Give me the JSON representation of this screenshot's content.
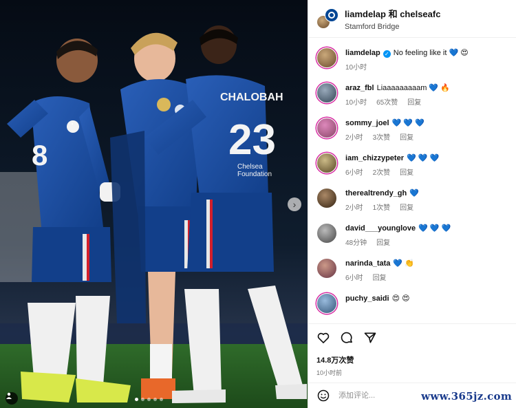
{
  "photo": {
    "jersey_name": "CHALOBAH",
    "jersey_number": "23",
    "left_number": "8",
    "foundation_text_1": "Chelsea",
    "foundation_text_2": "Foundation",
    "next_glyph": "›"
  },
  "header": {
    "title": "liamdelap 和 chelseafc",
    "location": "Stamford Bridge"
  },
  "comments": [
    {
      "user": "liamdelap",
      "verified": true,
      "text": "No feeling like it 💙 😍",
      "time": "10小时",
      "likes": "",
      "reply": ""
    },
    {
      "user": "araz_fbl",
      "verified": false,
      "text": "Liaaaaaaaaam 💙 🔥",
      "time": "10小时",
      "likes": "65次赞",
      "reply": "回复"
    },
    {
      "user": "sommy_joel",
      "verified": false,
      "text": "💙 💙 💙",
      "time": "2小时",
      "likes": "3次赞",
      "reply": "回复"
    },
    {
      "user": "iam_chizzypeter",
      "verified": false,
      "text": "💙 💙 💙",
      "time": "6小时",
      "likes": "2次赞",
      "reply": "回复"
    },
    {
      "user": "therealtrendy_gh",
      "verified": false,
      "text": "💙",
      "time": "2小时",
      "likes": "1次赞",
      "reply": "回复"
    },
    {
      "user": "david___younglove",
      "verified": false,
      "text": "💙 💙 💙",
      "time": "48分钟",
      "likes": "",
      "reply": "回复"
    },
    {
      "user": "narinda_tata",
      "verified": false,
      "text": "💙 👏",
      "time": "6小时",
      "likes": "",
      "reply": "回复"
    },
    {
      "user": "puchy_saidi",
      "verified": false,
      "text": "😍 😍",
      "time": "",
      "likes": "",
      "reply": ""
    }
  ],
  "post": {
    "likes": "14.8万次赞",
    "time": "10小时前"
  },
  "add_comment": {
    "placeholder": "添加评论..."
  },
  "watermark": "www.365jz.com",
  "colors": {
    "chelsea_blue": "#034694",
    "heart_blue": "#3d7be0",
    "verified": "#0095f6"
  },
  "icons": [
    "heart-icon",
    "comment-icon",
    "share-icon",
    "emoji-icon",
    "chevron-right-icon",
    "user-tag-icon"
  ]
}
